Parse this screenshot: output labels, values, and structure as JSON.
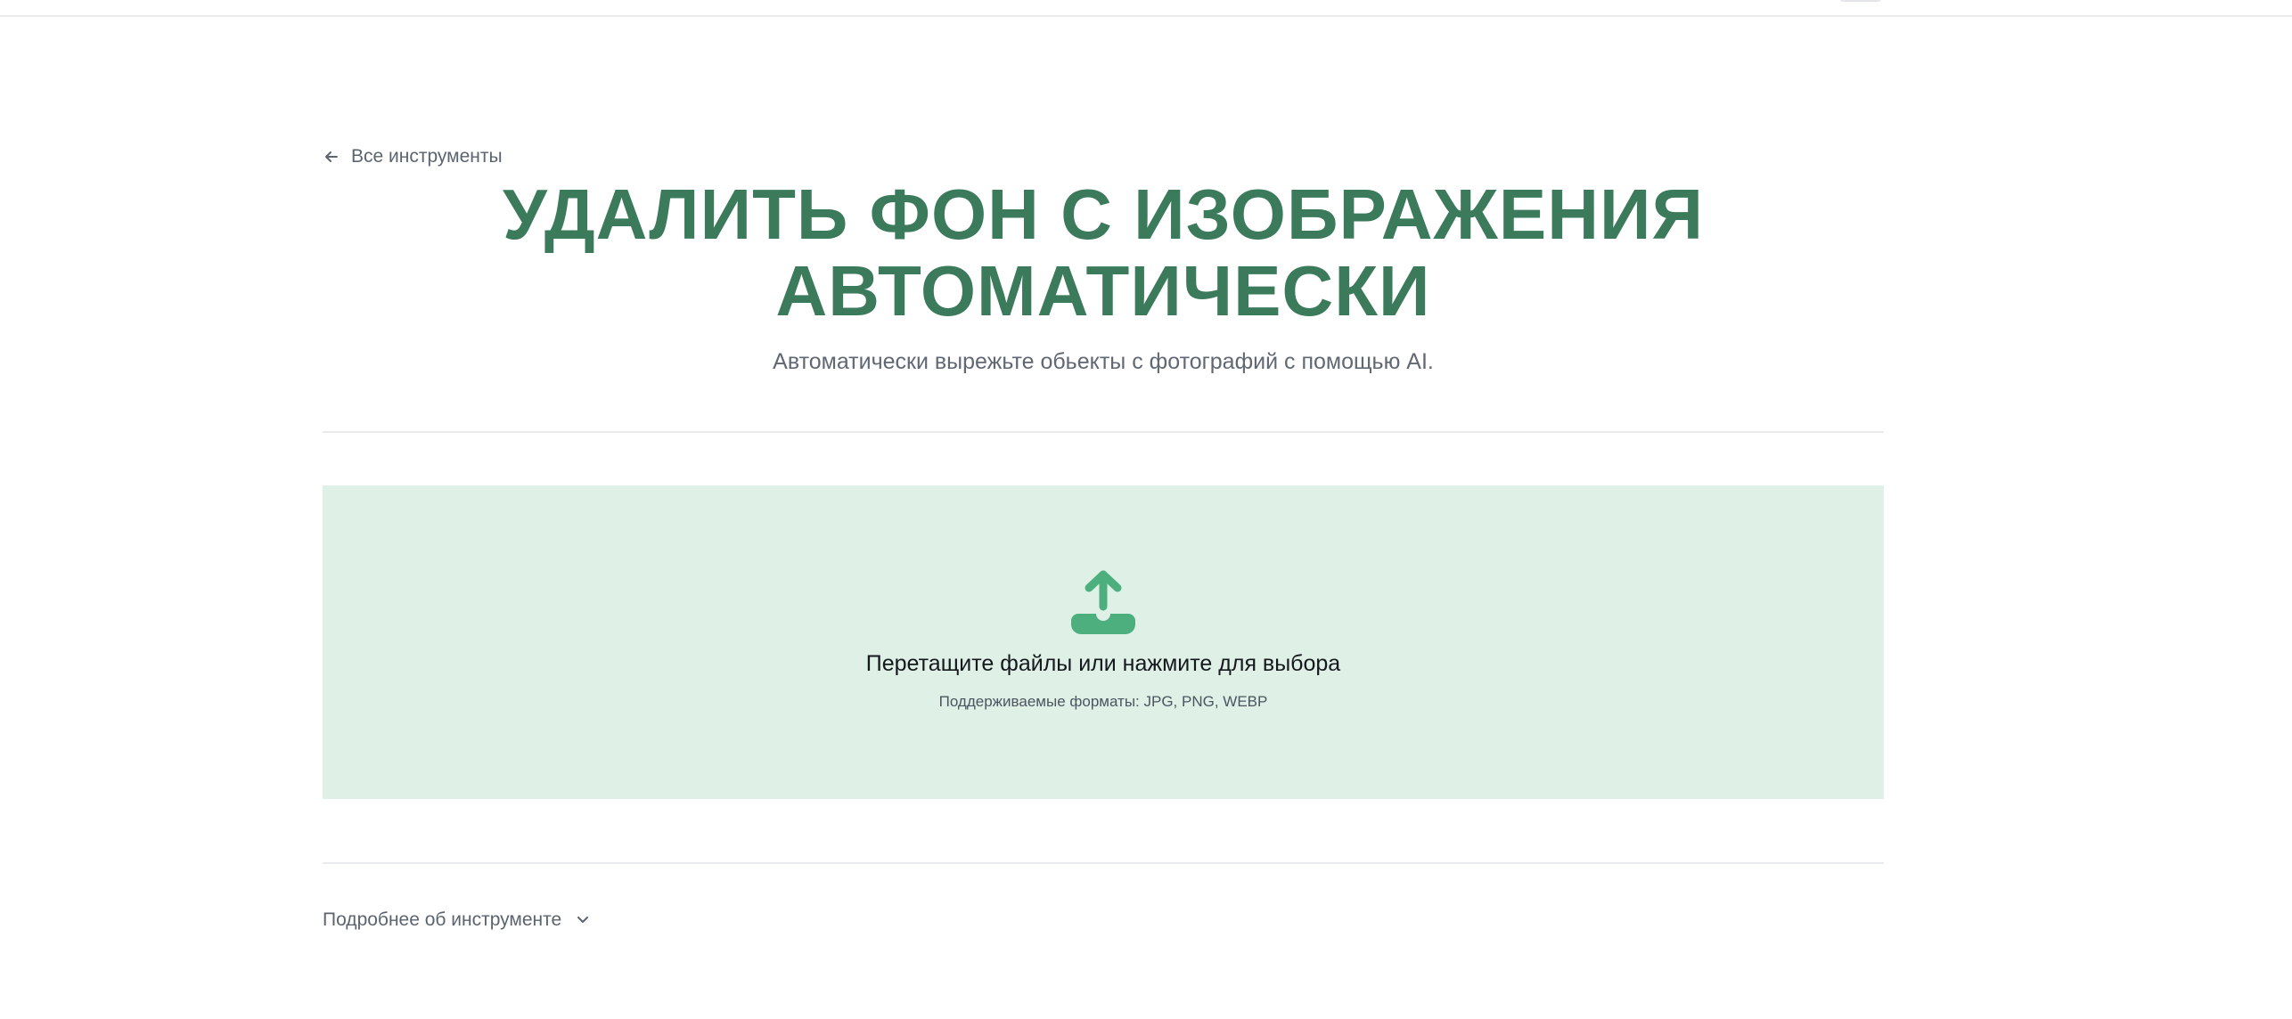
{
  "nav": {
    "back_label": "Все инструменты"
  },
  "hero": {
    "title_line_1": "УДАЛИТЬ ФОН С ИЗОБРАЖЕНИЯ",
    "title_line_2": "АВТОМАТИЧЕСКИ",
    "subtitle": "Автоматически вырежьте обьекты с фотографий с помощью AI."
  },
  "dropzone": {
    "title": "Перетащите файлы или нажмите для выбора",
    "formats": "Поддерживаемые форматы: JPG, PNG, WEBP",
    "icon": "upload-icon"
  },
  "details": {
    "label": "Подробнее об инструменте",
    "icon": "chevron-down-icon"
  },
  "colors": {
    "accent_green": "#3b7a5b",
    "dropzone_bg": "#dff0e6",
    "icon_green": "#4caf7d"
  }
}
